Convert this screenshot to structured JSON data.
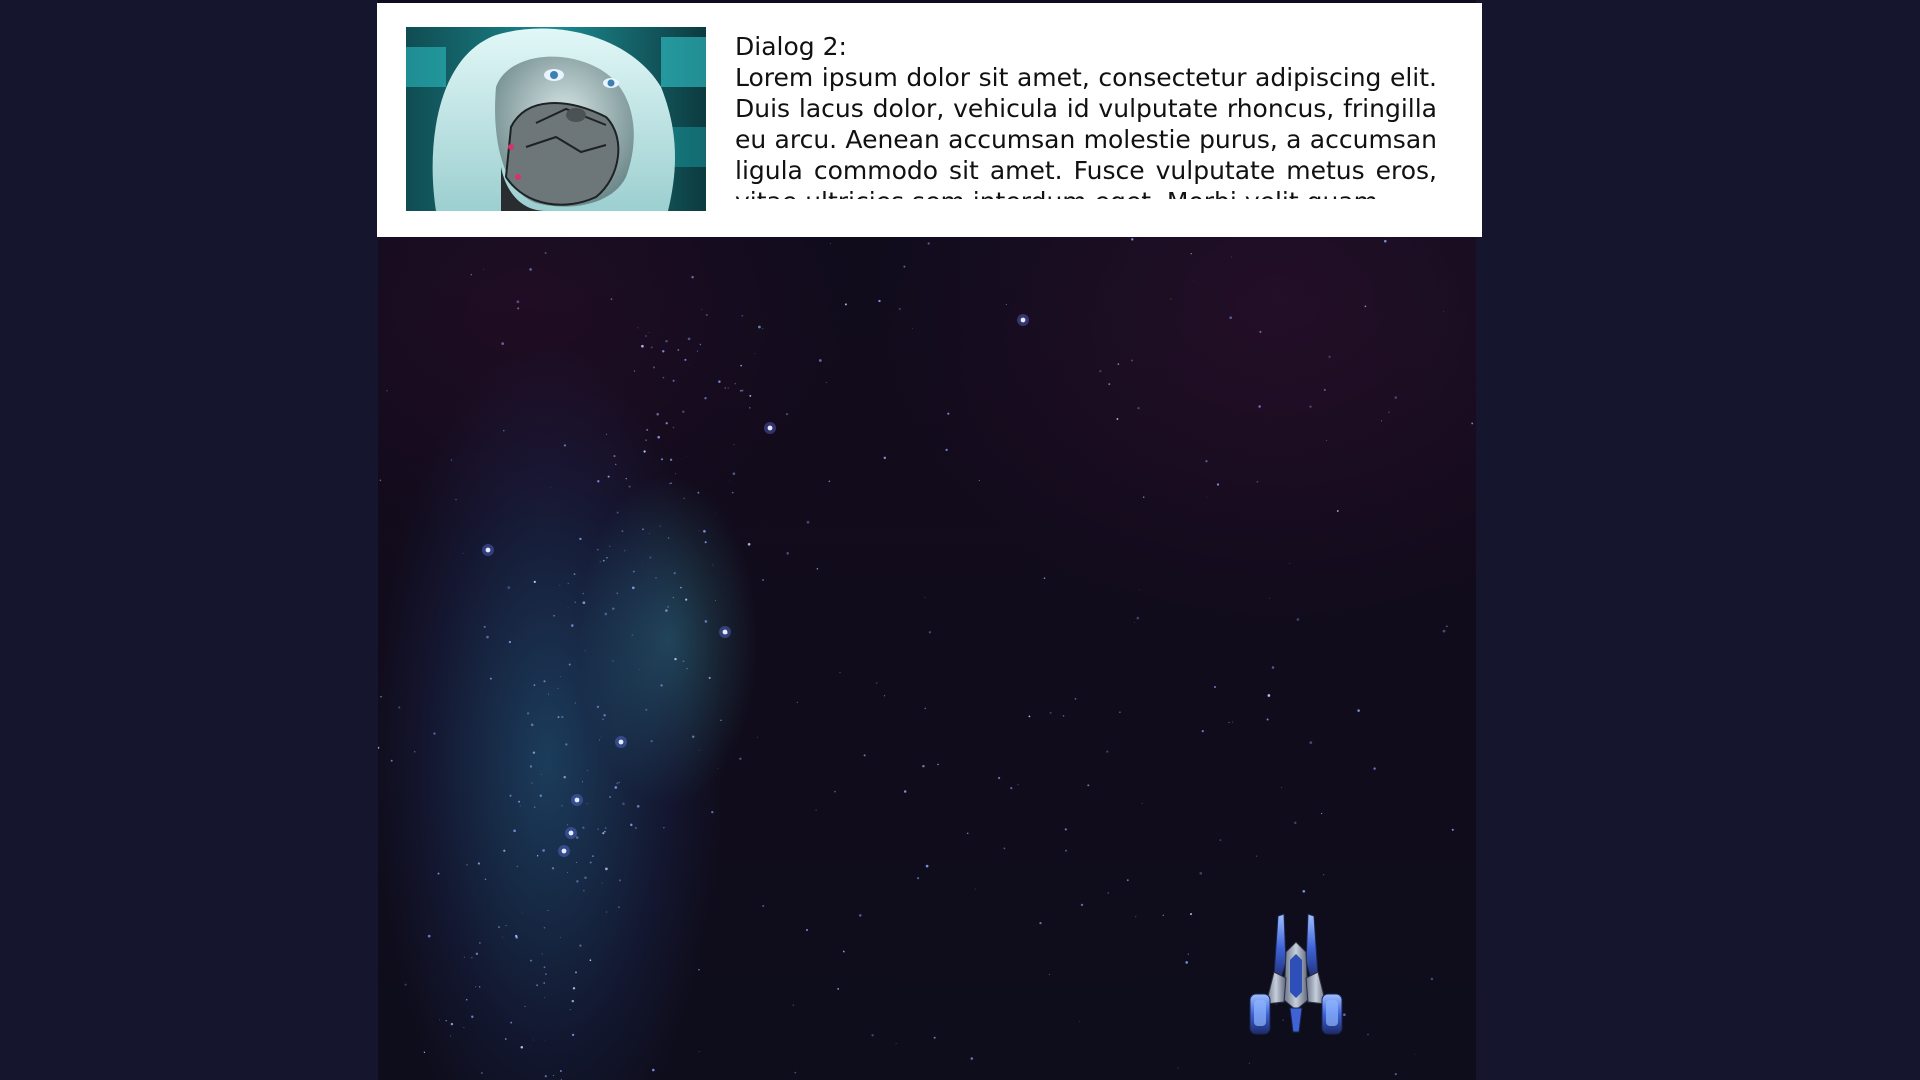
{
  "dialog": {
    "title": "Dialog 2:",
    "body": "Lorem ipsum dolor sit amet, consectetur adipiscing elit. Duis lacus dolor, vehicula id vulputate rhoncus, fringilla eu arcu. Aenean accumsan molestie purus, a accumsan ligula commodo sit amet. Fusce vulputate metus eros, vitae ultricies sem interdum eget. Morbi velit quam,",
    "portrait_icon": "android-face-portrait"
  },
  "player": {
    "ship_icon": "player-spaceship"
  },
  "colors": {
    "page_background": "#15162e",
    "dialog_background": "#ffffff",
    "dialog_text": "#111111",
    "ship_primary": "#3f63d6",
    "ship_accent": "#8fb6ff"
  }
}
